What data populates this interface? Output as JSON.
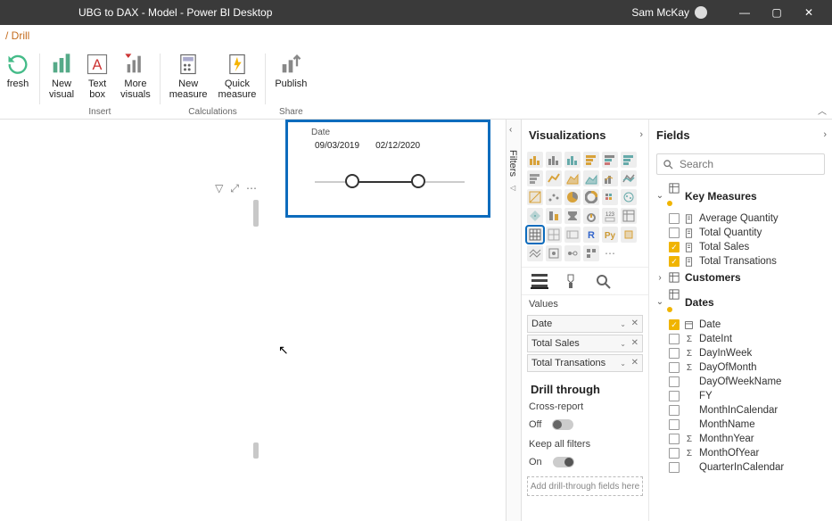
{
  "titlebar": {
    "title": "UBG to DAX - Model - Power BI Desktop",
    "user": "Sam McKay"
  },
  "breadcrumb": {
    "text": "/ Drill"
  },
  "ribbon": {
    "refresh": "fresh",
    "new_visual": "New\nvisual",
    "text_box": "Text\nbox",
    "more_visuals": "More\nvisuals",
    "new_measure": "New\nmeasure",
    "quick_measure": "Quick\nmeasure",
    "publish": "Publish",
    "group_insert": "Insert",
    "group_calc": "Calculations",
    "group_share": "Share"
  },
  "slicer": {
    "title": "Date",
    "from": "09/03/2019",
    "to": "02/12/2020"
  },
  "filters_tab": {
    "label": "Filters"
  },
  "vis": {
    "header": "Visualizations",
    "values_label": "Values",
    "wells": [
      {
        "name": "Date"
      },
      {
        "name": "Total Sales"
      },
      {
        "name": "Total Transations"
      }
    ],
    "drill_header": "Drill through",
    "cross_label": "Cross-report",
    "cross_state": "Off",
    "keep_label": "Keep all filters",
    "keep_state": "On",
    "dropzone": "Add drill-through fields here"
  },
  "fields": {
    "header": "Fields",
    "search_placeholder": "Search",
    "groups": {
      "key_measures": {
        "name": "Key Measures",
        "items": [
          {
            "label": "Average Quantity",
            "checked": false,
            "type": "measure"
          },
          {
            "label": "Total Quantity",
            "checked": false,
            "type": "measure"
          },
          {
            "label": "Total Sales",
            "checked": true,
            "type": "measure"
          },
          {
            "label": "Total Transations",
            "checked": true,
            "type": "measure"
          }
        ]
      },
      "customers": {
        "name": "Customers"
      },
      "dates": {
        "name": "Dates",
        "items": [
          {
            "label": "Date",
            "checked": true,
            "type": "hier"
          },
          {
            "label": "DateInt",
            "checked": false,
            "type": "sigma"
          },
          {
            "label": "DayInWeek",
            "checked": false,
            "type": "sigma"
          },
          {
            "label": "DayOfMonth",
            "checked": false,
            "type": "sigma"
          },
          {
            "label": "DayOfWeekName",
            "checked": false,
            "type": ""
          },
          {
            "label": "FY",
            "checked": false,
            "type": ""
          },
          {
            "label": "MonthInCalendar",
            "checked": false,
            "type": ""
          },
          {
            "label": "MonthName",
            "checked": false,
            "type": ""
          },
          {
            "label": "MonthnYear",
            "checked": false,
            "type": "sigma"
          },
          {
            "label": "MonthOfYear",
            "checked": false,
            "type": "sigma"
          },
          {
            "label": "QuarterInCalendar",
            "checked": false,
            "type": ""
          }
        ]
      }
    }
  }
}
